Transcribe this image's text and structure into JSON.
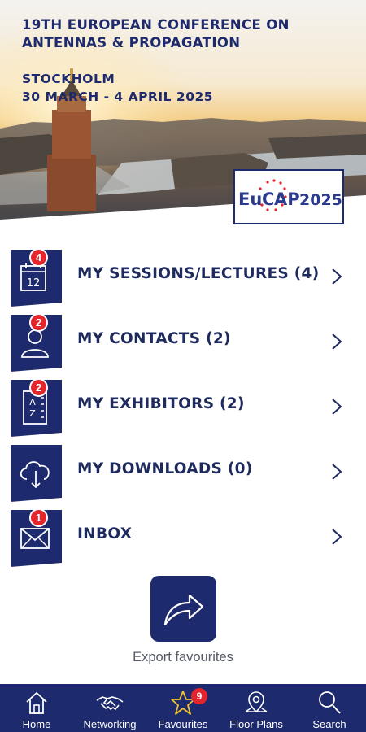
{
  "banner": {
    "title_line1": "19TH EUROPEAN CONFERENCE ON",
    "title_line2": "ANTENNAS & PROPAGATION",
    "location": "STOCKHOLM",
    "dates": "30 MARCH - 4 APRIL 2025",
    "logo_text": "EuCAP 2025"
  },
  "menu": {
    "items": [
      {
        "label": "MY SESSIONS/LECTURES (4)",
        "icon": "calendar-icon",
        "badge": "4"
      },
      {
        "label": "MY CONTACTS (2)",
        "icon": "person-icon",
        "badge": "2"
      },
      {
        "label": "MY EXHIBITORS (2)",
        "icon": "az-list-icon",
        "badge": "2"
      },
      {
        "label": "MY DOWNLOADS (0)",
        "icon": "cloud-download-icon",
        "badge": ""
      },
      {
        "label": "INBOX",
        "icon": "envelope-icon",
        "badge": "1"
      }
    ]
  },
  "export": {
    "label": "Export favourites",
    "icon": "share-arrow-icon"
  },
  "nav": {
    "items": [
      {
        "label": "Home",
        "icon": "home-icon"
      },
      {
        "label": "Networking",
        "icon": "handshake-icon"
      },
      {
        "label": "Favourites",
        "icon": "star-icon",
        "badge": "9"
      },
      {
        "label": "Floor Plans",
        "icon": "map-pin-icon"
      },
      {
        "label": "Search",
        "icon": "search-icon"
      }
    ]
  },
  "colors": {
    "brand": "#1e2a6e",
    "badge": "#e4262c",
    "star_active": "#f2c230"
  }
}
